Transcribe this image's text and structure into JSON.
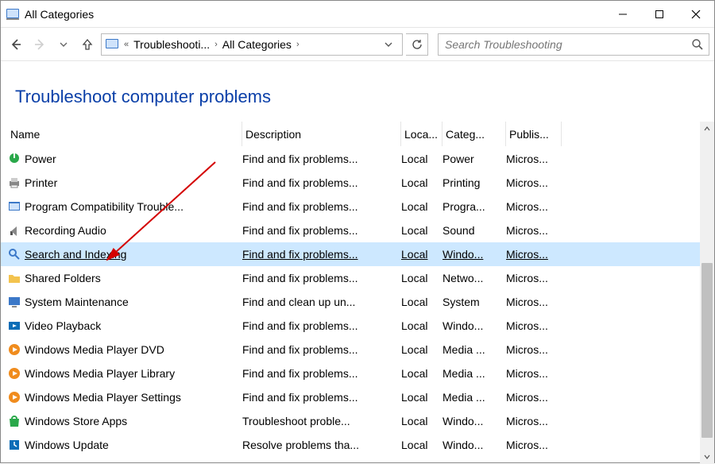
{
  "window": {
    "title": "All Categories"
  },
  "breadcrumbs": {
    "seg0": "«",
    "seg1": "Troubleshooti...",
    "seg2": "All Categories"
  },
  "search": {
    "placeholder": "Search Troubleshooting"
  },
  "heading": "Troubleshoot computer problems",
  "columns": {
    "name": "Name",
    "description": "Description",
    "location": "Loca...",
    "category": "Categ...",
    "publisher": "Publis..."
  },
  "rows": [
    {
      "name": "Power",
      "description": "Find and fix problems...",
      "location": "Local",
      "category": "Power",
      "publisher": "Micros...",
      "selected": false,
      "icon": "power"
    },
    {
      "name": "Printer",
      "description": "Find and fix problems...",
      "location": "Local",
      "category": "Printing",
      "publisher": "Micros...",
      "selected": false,
      "icon": "printer"
    },
    {
      "name": "Program Compatibility Trouble...",
      "description": "Find and fix problems...",
      "location": "Local",
      "category": "Progra...",
      "publisher": "Micros...",
      "selected": false,
      "icon": "program"
    },
    {
      "name": "Recording Audio",
      "description": "Find and fix problems...",
      "location": "Local",
      "category": "Sound",
      "publisher": "Micros...",
      "selected": false,
      "icon": "audio"
    },
    {
      "name": "Search and Indexing",
      "description": "Find and fix problems...",
      "location": "Local",
      "category": "Windo...",
      "publisher": "Micros...",
      "selected": true,
      "icon": "search"
    },
    {
      "name": "Shared Folders",
      "description": "Find and fix problems...",
      "location": "Local",
      "category": "Netwo...",
      "publisher": "Micros...",
      "selected": false,
      "icon": "folder"
    },
    {
      "name": "System Maintenance",
      "description": "Find and clean up un...",
      "location": "Local",
      "category": "System",
      "publisher": "Micros...",
      "selected": false,
      "icon": "system"
    },
    {
      "name": "Video Playback",
      "description": "Find and fix problems...",
      "location": "Local",
      "category": "Windo...",
      "publisher": "Micros...",
      "selected": false,
      "icon": "video"
    },
    {
      "name": "Windows Media Player DVD",
      "description": "Find and fix problems...",
      "location": "Local",
      "category": "Media ...",
      "publisher": "Micros...",
      "selected": false,
      "icon": "wmp"
    },
    {
      "name": "Windows Media Player Library",
      "description": "Find and fix problems...",
      "location": "Local",
      "category": "Media ...",
      "publisher": "Micros...",
      "selected": false,
      "icon": "wmp"
    },
    {
      "name": "Windows Media Player Settings",
      "description": "Find and fix problems...",
      "location": "Local",
      "category": "Media ...",
      "publisher": "Micros...",
      "selected": false,
      "icon": "wmp"
    },
    {
      "name": "Windows Store Apps",
      "description": "Troubleshoot proble...",
      "location": "Local",
      "category": "Windo...",
      "publisher": "Micros...",
      "selected": false,
      "icon": "store"
    },
    {
      "name": "Windows Update",
      "description": "Resolve problems tha...",
      "location": "Local",
      "category": "Windo...",
      "publisher": "Micros...",
      "selected": false,
      "icon": "update"
    }
  ]
}
